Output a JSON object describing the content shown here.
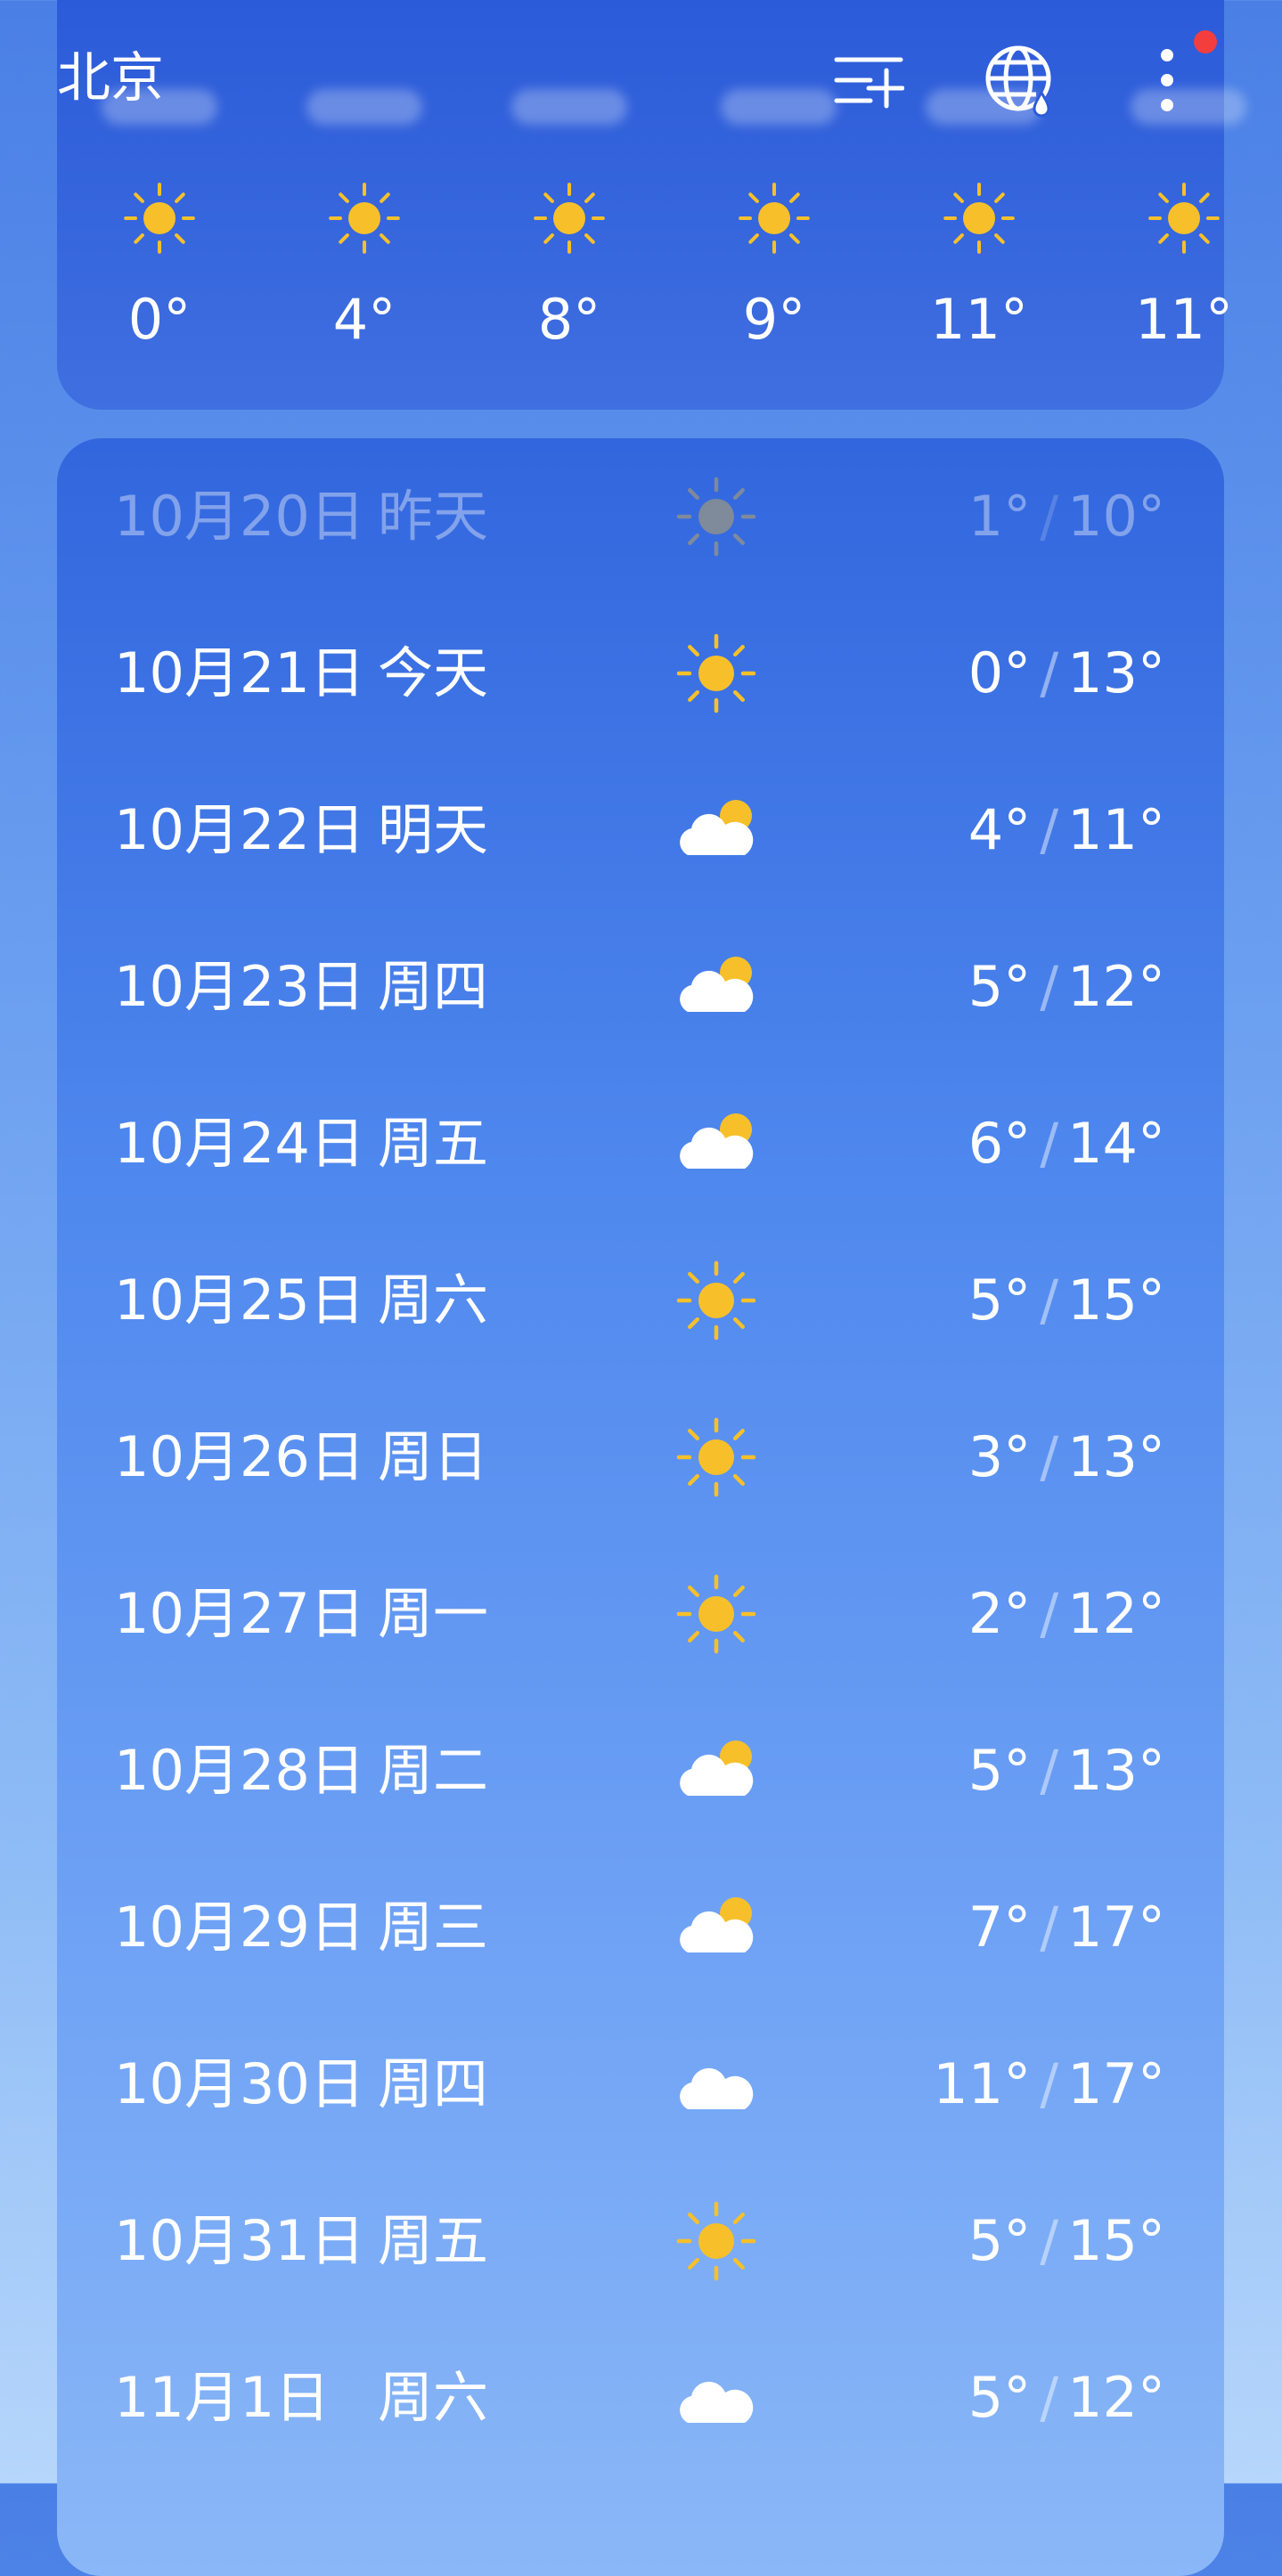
{
  "header": {
    "city": "北京"
  },
  "hourly": [
    {
      "icon": "sun-icon",
      "temp": "0°"
    },
    {
      "icon": "sun-icon",
      "temp": "4°"
    },
    {
      "icon": "sun-icon",
      "temp": "8°"
    },
    {
      "icon": "sun-icon",
      "temp": "9°"
    },
    {
      "icon": "sun-icon",
      "temp": "11°"
    },
    {
      "icon": "sun-icon",
      "temp": "11°"
    }
  ],
  "daily": [
    {
      "date": "10月20日",
      "weekday": "昨天",
      "icon": "sun-icon",
      "low": "1°",
      "high": "10°",
      "past": true
    },
    {
      "date": "10月21日",
      "weekday": "今天",
      "icon": "sun-icon",
      "low": "0°",
      "high": "13°"
    },
    {
      "date": "10月22日",
      "weekday": "明天",
      "icon": "partly-cloudy-icon",
      "low": "4°",
      "high": "11°"
    },
    {
      "date": "10月23日",
      "weekday": "周四",
      "icon": "partly-cloudy-icon",
      "low": "5°",
      "high": "12°"
    },
    {
      "date": "10月24日",
      "weekday": "周五",
      "icon": "partly-cloudy-icon",
      "low": "6°",
      "high": "14°"
    },
    {
      "date": "10月25日",
      "weekday": "周六",
      "icon": "sun-icon",
      "low": "5°",
      "high": "15°"
    },
    {
      "date": "10月26日",
      "weekday": "周日",
      "icon": "sun-icon",
      "low": "3°",
      "high": "13°"
    },
    {
      "date": "10月27日",
      "weekday": "周一",
      "icon": "sun-icon",
      "low": "2°",
      "high": "12°"
    },
    {
      "date": "10月28日",
      "weekday": "周二",
      "icon": "partly-cloudy-icon",
      "low": "5°",
      "high": "13°"
    },
    {
      "date": "10月29日",
      "weekday": "周三",
      "icon": "partly-cloudy-icon",
      "low": "7°",
      "high": "17°"
    },
    {
      "date": "10月30日",
      "weekday": "周四",
      "icon": "cloud-icon",
      "low": "11°",
      "high": "17°"
    },
    {
      "date": "10月31日",
      "weekday": "周五",
      "icon": "sun-icon",
      "low": "5°",
      "high": "15°"
    },
    {
      "date": "11月1日",
      "weekday": "周六",
      "icon": "cloud-icon",
      "low": "5°",
      "high": "12°"
    }
  ],
  "colors": {
    "sun": "#f7c02a",
    "card_top": "#2c5bd9",
    "accent_dot": "#f43d3d"
  }
}
